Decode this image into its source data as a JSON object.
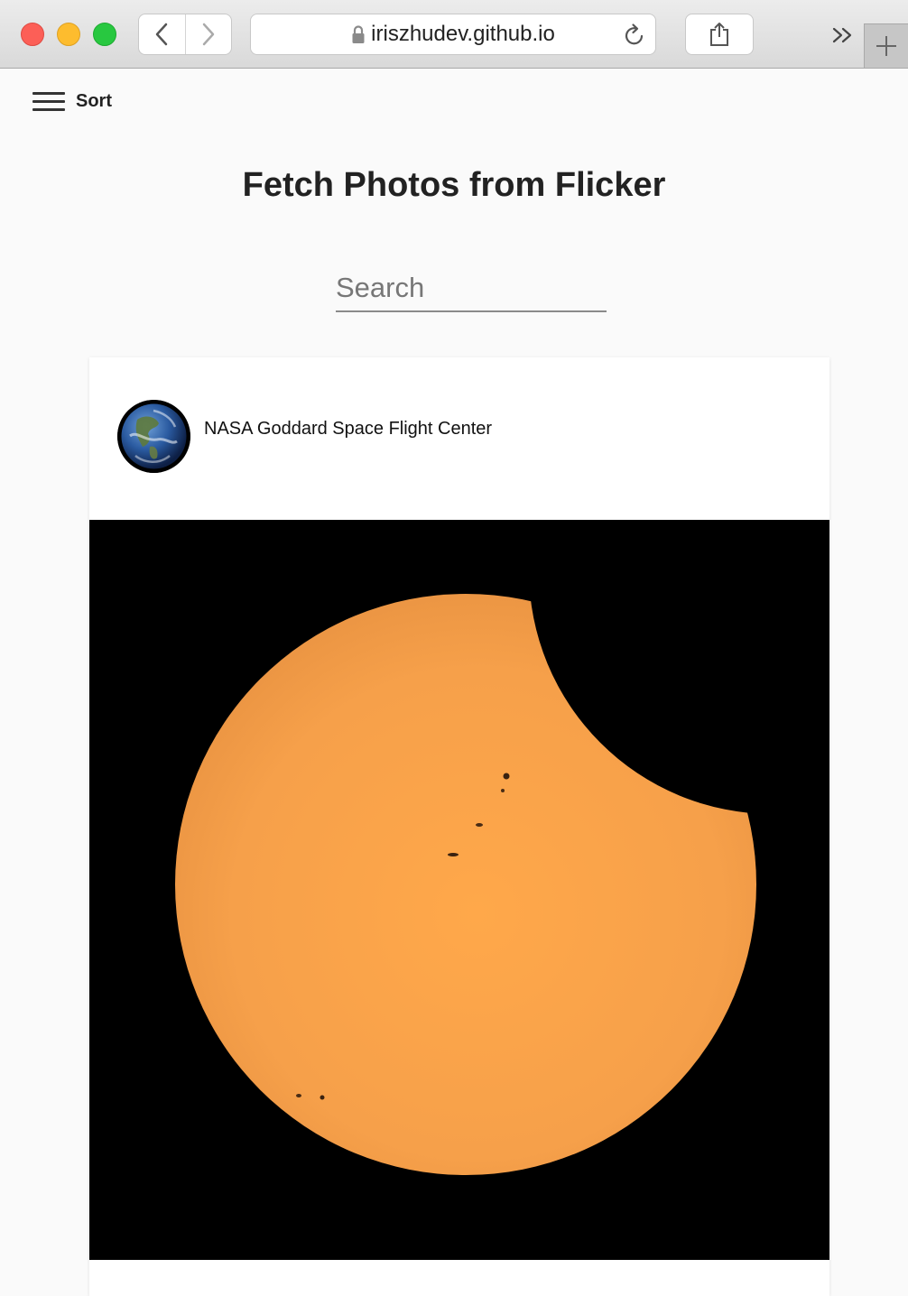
{
  "browser": {
    "url": "iriszhudev.github.io",
    "icons": {
      "back": "chevron-left-icon",
      "forward": "chevron-right-icon",
      "secure": "lock-icon",
      "reload": "reload-icon",
      "share": "share-icon",
      "more": "double-chevron-icon",
      "new_tab": "plus-icon"
    }
  },
  "page": {
    "sort_label": "Sort",
    "title": "Fetch Photos from Flicker",
    "search_placeholder": "Search"
  },
  "photo_card": {
    "author": "NASA Goddard Space Flight Center",
    "avatar": "earth-avatar",
    "image": "partial-solar-eclipse"
  },
  "colors": {
    "sun": "#f5a347",
    "photo_background": "#000000",
    "page_background": "#fafafa"
  }
}
